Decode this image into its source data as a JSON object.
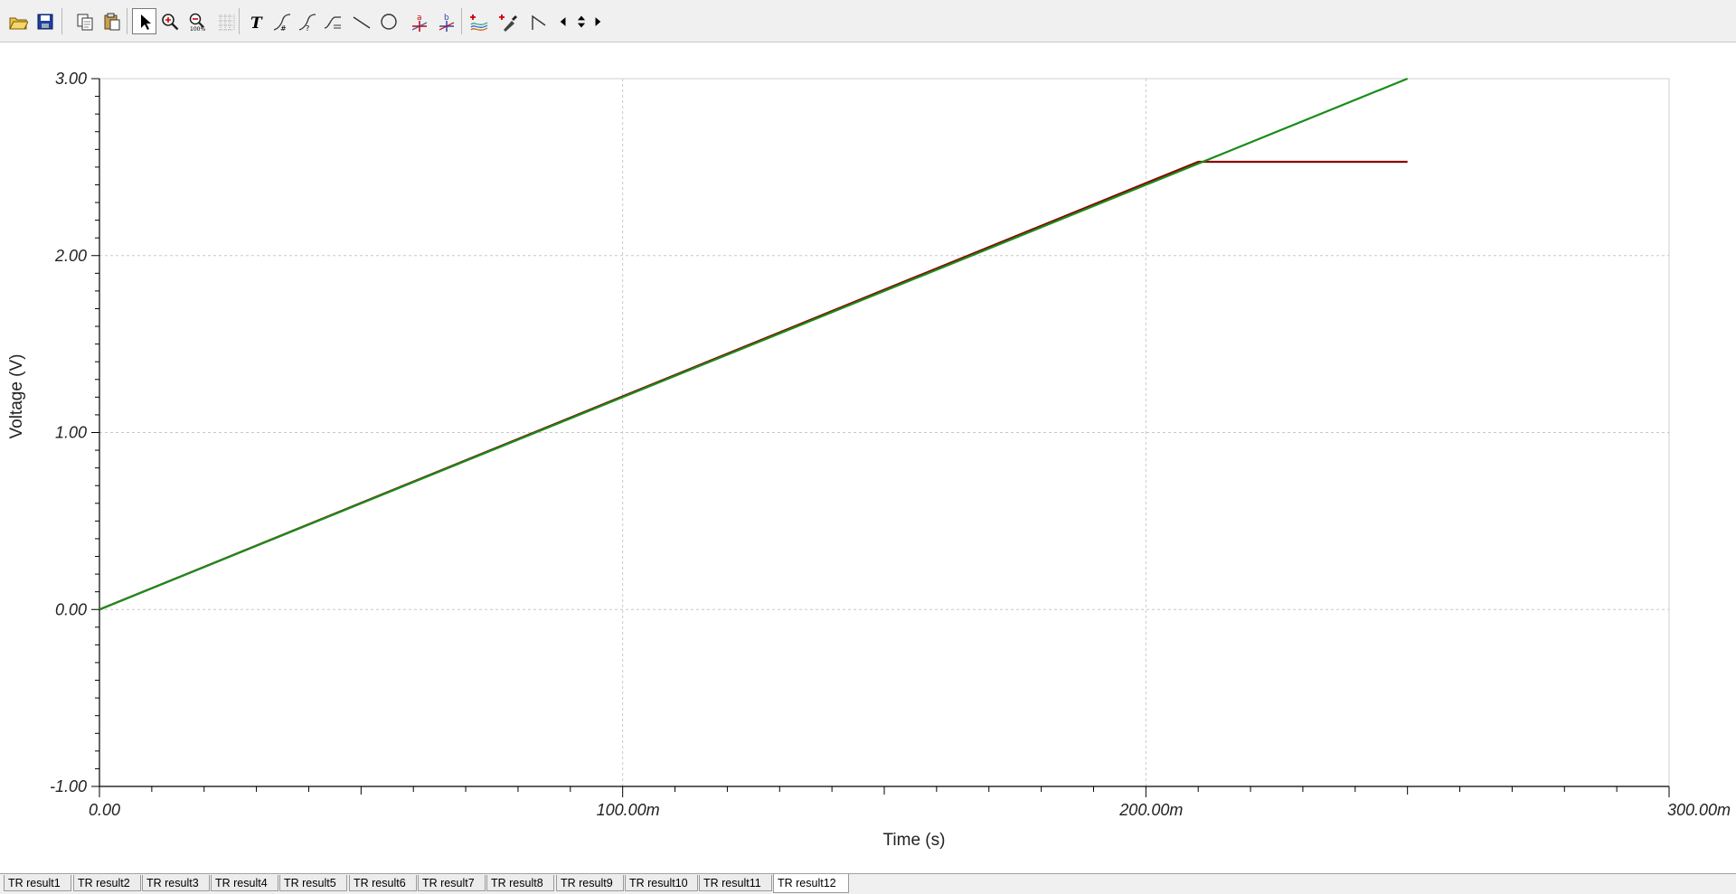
{
  "toolbar": {
    "buttons": [
      {
        "name": "open-folder",
        "pressed": false
      },
      {
        "name": "save",
        "pressed": false
      },
      {
        "name": "copy",
        "pressed": false
      },
      {
        "name": "paste",
        "pressed": false
      },
      {
        "name": "select-pointer",
        "pressed": true
      },
      {
        "name": "zoom-in",
        "pressed": false
      },
      {
        "name": "zoom-100",
        "pressed": false
      },
      {
        "name": "grid",
        "pressed": false
      },
      {
        "name": "text",
        "pressed": false
      },
      {
        "name": "curve-label-1",
        "pressed": false
      },
      {
        "name": "curve-label-2",
        "pressed": false
      },
      {
        "name": "curve-label-3",
        "pressed": false
      },
      {
        "name": "line",
        "pressed": false
      },
      {
        "name": "circle",
        "pressed": false
      },
      {
        "name": "cursor-a",
        "pressed": false
      },
      {
        "name": "cursor-b",
        "pressed": false
      },
      {
        "name": "add-curves",
        "pressed": false
      },
      {
        "name": "probe",
        "pressed": false
      },
      {
        "name": "polyline",
        "pressed": false
      },
      {
        "name": "nav-left",
        "pressed": false
      },
      {
        "name": "nav-updown",
        "pressed": false
      },
      {
        "name": "nav-right",
        "pressed": false
      }
    ]
  },
  "tabs": [
    {
      "label": "TR result1",
      "active": false
    },
    {
      "label": "TR result2",
      "active": false
    },
    {
      "label": "TR result3",
      "active": false
    },
    {
      "label": "TR result4",
      "active": false
    },
    {
      "label": "TR result5",
      "active": false
    },
    {
      "label": "TR result6",
      "active": false
    },
    {
      "label": "TR result7",
      "active": false
    },
    {
      "label": "TR result8",
      "active": false
    },
    {
      "label": "TR result9",
      "active": false
    },
    {
      "label": "TR result10",
      "active": false
    },
    {
      "label": "TR result11",
      "active": false
    },
    {
      "label": "TR result12",
      "active": true
    }
  ],
  "chart_data": {
    "type": "line",
    "xlabel": "Time (s)",
    "ylabel": "Voltage (V)",
    "xlim": [
      0,
      0.3
    ],
    "ylim": [
      -1,
      3
    ],
    "x_ticks": [
      0,
      0.1,
      0.2,
      0.3
    ],
    "x_tick_labels": [
      "0.00",
      "100.00m",
      "200.00m",
      "300.00m"
    ],
    "y_ticks": [
      -1,
      0,
      1,
      2,
      3
    ],
    "y_tick_labels": [
      "-1.00",
      "0.00",
      "1.00",
      "2.00",
      "3.00"
    ],
    "grid": true,
    "series": [
      {
        "color": "#8b0000",
        "x": [
          0,
          0.21,
          0.25
        ],
        "y": [
          0,
          2.53,
          2.53
        ]
      },
      {
        "color": "#1a8c1a",
        "x": [
          0,
          0.25
        ],
        "y": [
          0,
          3.0
        ]
      }
    ]
  }
}
